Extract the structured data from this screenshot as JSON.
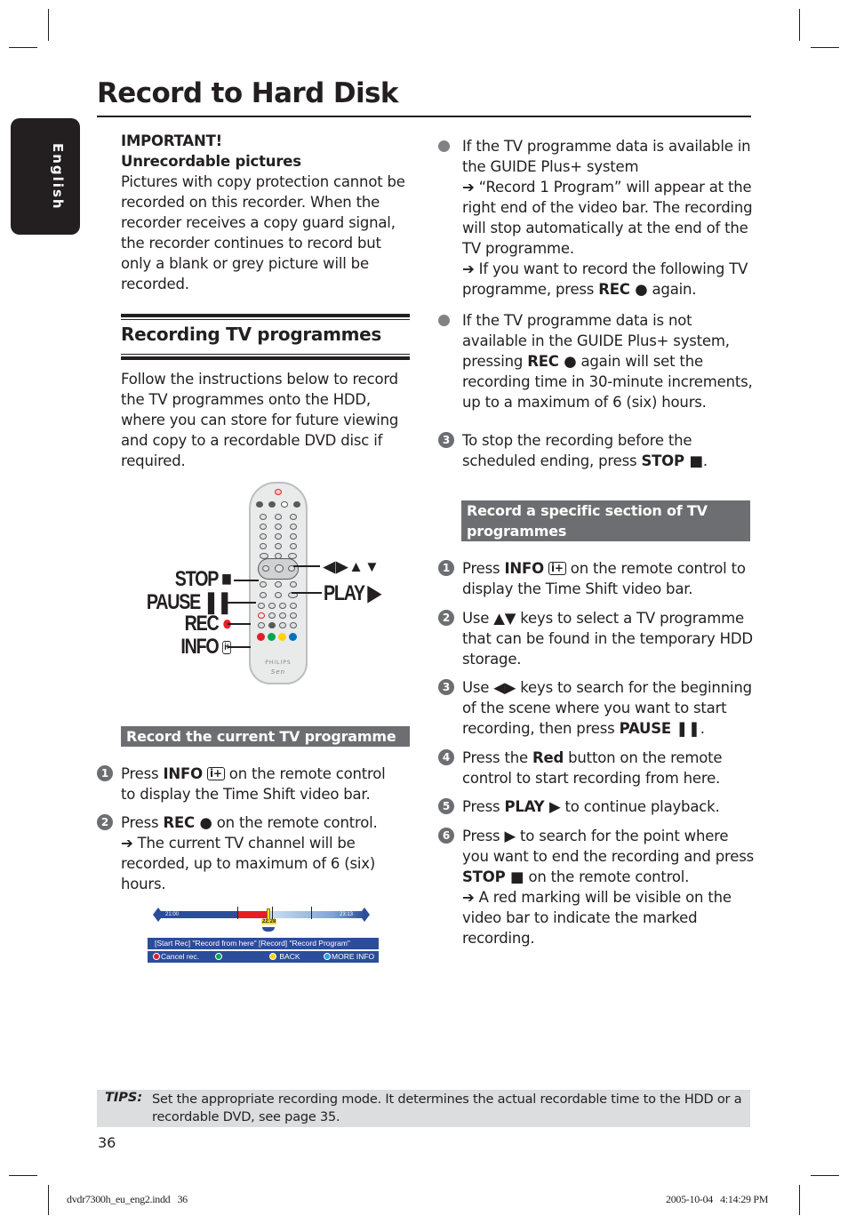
{
  "page": {
    "title": "Record to Hard Disk",
    "language_tab": "English",
    "page_number": "36"
  },
  "important": {
    "heading": "IMPORTANT!",
    "subheading": "Unrecordable pictures",
    "body": "Pictures with copy protection cannot be recorded on this recorder.  When the recorder receives a copy guard signal, the recorder continues to record but only a blank or grey picture will be recorded."
  },
  "section": {
    "title": "Recording TV programmes",
    "intro": "Follow the instructions below to record the TV programmes onto the HDD, where you can store for future viewing and copy to a recordable DVD disc if required."
  },
  "remote_figure": {
    "labels": {
      "stop": "STOP",
      "pause": "PAUSE",
      "rec": "REC",
      "info": "INFO",
      "arrows": "◀▶▲▼",
      "play": "PLAY"
    },
    "brand": "PHILIPS",
    "button_colors": [
      "#e31e24",
      "#00a651",
      "#ffd200",
      "#0072bc"
    ],
    "rec_color": "#e8202a"
  },
  "record_current": {
    "header": "Record the current TV programme",
    "steps": [
      {
        "num": "1",
        "pre": "Press ",
        "key": "INFO",
        "post": " on the remote control to display the Time Shift video bar."
      },
      {
        "num": "2",
        "pre": "Press ",
        "key": "REC ●",
        "post": " on the remote control.",
        "result": "➔ The current TV channel will be recorded, up to maximum of 6 (six) hours."
      }
    ]
  },
  "video_bar": {
    "start_time": "21:00",
    "end_time": "23:13",
    "current_time": "22:28",
    "hint": "[Start Rec] \"Record from here\"  [Record] \"Record Program\"",
    "buttons": [
      {
        "color": "#e31e24",
        "label": "Cancel rec."
      },
      {
        "color": "#00a651",
        "label": ""
      },
      {
        "color": "#ffd200",
        "label": "BACK"
      },
      {
        "color": "#2aa0e0",
        "label": "MORE INFO"
      }
    ]
  },
  "right_column": {
    "bullets": [
      {
        "text": "If the TV programme data is available in the GUIDE Plus+ system",
        "results": [
          "➔ “Record 1 Program” will appear at the right end of the video bar. The recording will stop automatically at the end of the TV programme."
        ],
        "result2_pre": "➔ If you want to record the following TV programme, press ",
        "result2_key": "REC ●",
        "result2_post": " again."
      },
      {
        "pre": "If the TV programme data is not available in the GUIDE Plus+ system, pressing ",
        "key": "REC ●",
        "post": " again will set the recording time in 30-minute increments, up to a maximum of 6 (six) hours."
      }
    ],
    "step3": {
      "num": "3",
      "pre": "To stop the recording before the scheduled ending, press ",
      "key": "STOP ■",
      "post": "."
    }
  },
  "record_section": {
    "header": "Record a specific section of TV programmes",
    "steps": [
      {
        "num": "1",
        "pre": "Press ",
        "key": "INFO",
        "post": " on the remote control to display the Time Shift video bar."
      },
      {
        "num": "2",
        "pre": "Use ▲▼ keys to select a TV programme that can be found in the temporary HDD storage.",
        "key": "",
        "post": ""
      },
      {
        "num": "3",
        "pre": "Use ◀▶ keys to search for the beginning of the scene where you want to start recording, then press ",
        "key": "PAUSE ❚❚",
        "post": "."
      },
      {
        "num": "4",
        "pre": "Press the ",
        "key": "Red",
        "post": " button on the remote control to start recording from here."
      },
      {
        "num": "5",
        "pre": "Press ",
        "key": "PLAY ▶",
        "post": " to continue playback."
      },
      {
        "num": "6",
        "pre": "Press ▶ to search for the point where you want to end the recording and press ",
        "key": "STOP ■",
        "post": " on the remote control.",
        "result": "➔ A red marking will be visible on the video bar to indicate the marked recording."
      }
    ]
  },
  "tips": {
    "label": "TIPS:",
    "text": "Set the appropriate recording mode. It determines the actual recordable time to the HDD or a recordable DVD, see page 35."
  },
  "slug": {
    "file": "dvdr7300h_eu_eng2.indd   36",
    "timestamp": "2005-10-04   4:14:29 PM"
  }
}
